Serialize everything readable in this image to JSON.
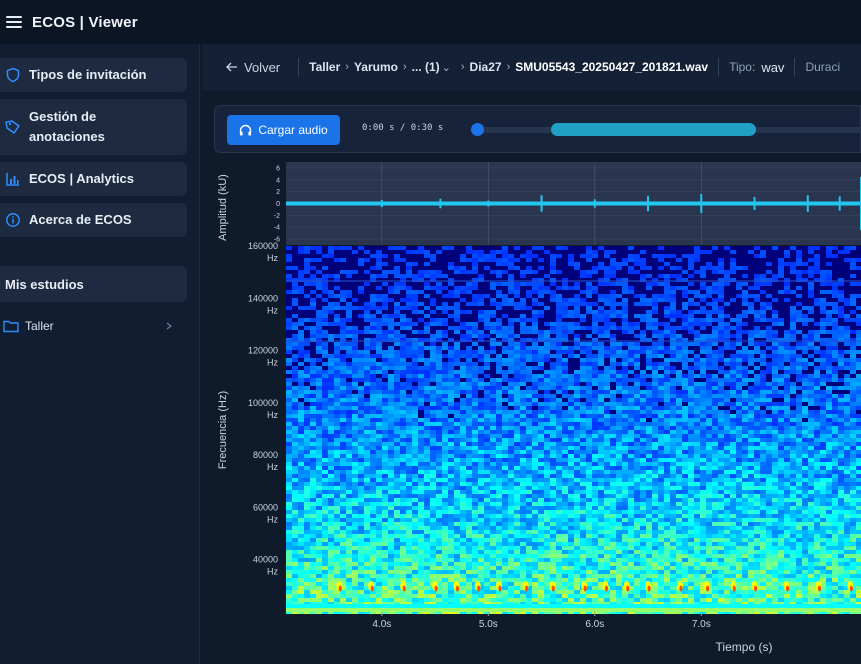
{
  "app": {
    "title": "ECOS | Viewer"
  },
  "sidebar": {
    "items": [
      {
        "label": "Tipos de invitación",
        "icon": "shield-icon"
      },
      {
        "label": "Gestión de anotaciones",
        "icon": "tag-icon"
      },
      {
        "label": "ECOS | Analytics",
        "icon": "bar-chart-icon"
      },
      {
        "label": "Acerca de ECOS",
        "icon": "info-icon"
      }
    ],
    "studies_title": "Mis estudios",
    "tree": [
      {
        "label": "Taller",
        "icon": "folder-icon"
      }
    ]
  },
  "breadcrumb": {
    "back_label": "Volver",
    "items": [
      "Taller",
      "Yarumo",
      "... (1)",
      "Dia27"
    ],
    "current": "SMU05543_20250427_201821.wav",
    "tipo_label": "Tipo:",
    "tipo_value": "wav",
    "duration_label": "Duraci"
  },
  "player": {
    "load_label": "Cargar audio",
    "timecode": "0:00 s / 0:30 s",
    "progress_segment": {
      "start": 0.19,
      "end": 0.73
    }
  },
  "colors": {
    "accent": "#1a73e8",
    "waveform": "#22c7f0",
    "background": "#0f1a2b"
  },
  "chart_data": [
    {
      "type": "line",
      "title": "",
      "ylabel": "Amplitud (kU)",
      "yticks": [
        "6",
        "4",
        "2",
        "0",
        "-2",
        "-4",
        "-6"
      ],
      "ylim": [
        -7,
        7
      ],
      "grid": true,
      "series": [
        {
          "x": [
            3.4,
            4.0,
            4.55,
            5.0,
            5.5,
            6.0,
            6.5,
            7.0,
            7.5,
            8.0,
            8.3,
            8.5
          ],
          "y": [
            0.3,
            0.6,
            0.8,
            0.5,
            1.4,
            0.7,
            1.3,
            1.6,
            1.1,
            1.4,
            1.2,
            4.5
          ]
        }
      ]
    },
    {
      "type": "heatmap",
      "title": "",
      "xlabel": "Tiempo (s)",
      "ylabel": "Frecuencia (Hz)",
      "xticks": [
        "4.0s",
        "5.0s",
        "6.0s",
        "7.0s"
      ],
      "xtick_values": [
        4.0,
        5.0,
        6.0,
        7.0
      ],
      "xlim": [
        3.1,
        8.5
      ],
      "yticks": [
        {
          "value": 160000,
          "label": "160000",
          "unit": "Hz"
        },
        {
          "value": 140000,
          "label": "140000",
          "unit": "Hz"
        },
        {
          "value": 120000,
          "label": "120000",
          "unit": "Hz"
        },
        {
          "value": 100000,
          "label": "100000",
          "unit": "Hz"
        },
        {
          "value": 80000,
          "label": "80000",
          "unit": "Hz"
        },
        {
          "value": 60000,
          "label": "60000",
          "unit": "Hz"
        },
        {
          "value": 40000,
          "label": "40000",
          "unit": "Hz"
        }
      ],
      "ylim": [
        20000,
        160000
      ],
      "colormap": "jet",
      "calls": [
        3.6,
        3.9,
        4.2,
        4.5,
        4.7,
        4.9,
        5.1,
        5.35,
        5.6,
        5.9,
        6.1,
        6.3,
        6.5,
        6.8,
        7.05,
        7.3,
        7.5,
        7.8,
        8.1,
        8.4
      ]
    }
  ]
}
